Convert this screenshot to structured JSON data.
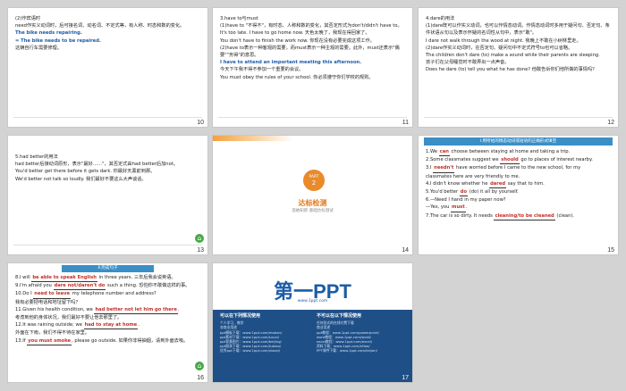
{
  "slides": {
    "s10": {
      "page": "10",
      "lines": [
        "(2)作宾语时",
        "need作实义动词时，后可接名词、动名词、不定式等，有人称、时态和数的变化。",
        "The bike needs repairing.",
        "= The bike needs to be repaired.",
        "这辆自行车需要修理。"
      ]
    },
    "s11": {
      "page": "11",
      "lines": [
        "3.have to与must",
        "(1)have to \"不得不\"，有时态、人称和数的变化，其否定形式为don't/didn't have to。",
        "It's too late. I have to go home now. 天色太晚了，我现在得回家了。",
        "You don't have to finish the work now. 你现在没有必要完成这项工作。",
        "(2)have to表示一种客观的需要，而must表示一种主观的需要。此外，must还表示\"偶要\"\"务得\"的意思。",
        "I have to attend an important meeting this afternoon.",
        "今天下午我不得不参加一个重要的会议。",
        "You must obey the rules of your school. 你必须遵守你们学校的规则。"
      ]
    },
    "s12": {
      "page": "12",
      "lines": [
        "4.dare的用法",
        "(1)dare既可以作实义动词，也可以作情态动词。作情态动词时多用于疑问句、否定句、条件状语从句以及表示怀疑的名词性从句中，表示\"敢\"。",
        "I dare not walk through the wood at night. 我晚上不敢在小树林里走。",
        "(2)dare作实义动词时，在否定句、疑问句中不定式符号to也可以省略。",
        "The children don't dare (to) make a sound while their parents are sleeping.",
        "孩子们在父母睡觉时不敢弄出一点声音。",
        "Does he dare (to) tell you what he has done? 他敢告诉你们他所做的事情吗？"
      ]
    },
    "s13": {
      "page": "13",
      "lines": [
        "5.had better的用法",
        "had better后接动词原形，表示\"最好……\"，其否定式由had better后加not。",
        "You'd better get there before it gets dark. 你最好天黑前到那。",
        "We'd better not talk so loudly. 我们最好不要这么大声谈话。"
      ]
    },
    "s14": {
      "page": "14",
      "part": "PART",
      "part_num": "2",
      "title": "达标检测",
      "subtitle": "温故知新  基础达标测试"
    },
    "s15": {
      "page": "15",
      "banner": "Ⅰ.用所给的情态动词或短语的正确形式填空",
      "lines": [
        {
          "pre": "1.We ",
          "ans": "can",
          "post": " choose between staying at home and taking a trip."
        },
        {
          "pre": "2.Some classmates suggest we ",
          "ans": "should",
          "post": " go to places of interest nearby."
        },
        {
          "pre": "3.I ",
          "ans": "needn't",
          "post": " have worried before I came to the new school, for my"
        },
        {
          "pre": "classmates here are very friendly to me.",
          "ans": "",
          "post": ""
        },
        {
          "pre": "4.I didn't know whether he ",
          "ans": "dared",
          "post": " say that to him."
        },
        {
          "pre": "5.You'd better ",
          "ans": "do",
          "post": " (do) it all by yourself."
        },
        {
          "pre": "6.—Need I hand in my paper now?",
          "ans": "",
          "post": ""
        },
        {
          "pre": "—Yes, you ",
          "ans": "must",
          "post": "."
        },
        {
          "pre": "7.The car is so dirty. It needs ",
          "ans": "cleaning/to be cleaned",
          "post": " (clean)."
        }
      ]
    },
    "s16": {
      "page": "16",
      "banner": "Ⅱ.完成句子",
      "lines": [
        {
          "pre": "8.I will ",
          "ans": "be able to speak English",
          "post": " in three years. 三年后我会说英语。"
        },
        {
          "pre": "9.I'm afraid you ",
          "ans": "dare not/daren't do",
          "post": " such a thing. 恐怕你不敢做这样的事。"
        },
        {
          "pre": "10.Do I ",
          "ans": "need to leave",
          "post": " my telephone number and address?"
        },
        {
          "pre": "我有必要把电话和地址留下吗？",
          "ans": "",
          "post": ""
        },
        {
          "pre": "11.Given his health condition, we ",
          "ans": "had better not let him go there",
          "post": "."
        },
        {
          "pre": "考虑到他的身体状况，我们最好不要让他去那里了。",
          "ans": "",
          "post": ""
        },
        {
          "pre": "12.It was raining outside; we ",
          "ans": "had to stay at home",
          "post": "."
        },
        {
          "pre": "外面在下雨，我们不得不待在家里。",
          "ans": "",
          "post": ""
        },
        {
          "pre": "13.If ",
          "ans": "you must smoke",
          "post": ", please go outside. 如果你非得抽烟，请到外面去吸。"
        }
      ]
    },
    "s17": {
      "page": "17",
      "logo": "第一PPT",
      "url": "www.1ppt.com",
      "left_title": "可以在下列情况使用",
      "left_lines": [
        "个人学习、教学",
        "非商业用途",
        "ppt模板下载：www.1ppt.com/moban/",
        "ppt素材下载：www.1ppt.com/sucai/",
        "ppt背景图片：www.1ppt.com/beijing/",
        "ppt图表下载：www.1ppt.com/tubiao/",
        "优秀ppt下载：www.1ppt.com/xiazai/"
      ],
      "right_title": "不可以在以下情况使用",
      "right_lines": [
        "任何形式的在线付费下载",
        "商业用途",
        "ppt教程：www.1ppt.com/powerpoint/",
        "word教程：www.1ppt.com/word/",
        "excel教程：www.1ppt.com/excel/",
        "资料下载：www.1ppt.com/ziliao/",
        "PPT课件下载：www.1ppt.com/kejian/"
      ]
    }
  },
  "colors": {
    "accent_blue": "#1e5aa8",
    "answer_red": "#c0302a",
    "banner": "#3a8fc7",
    "part_orange": "#e98a2b"
  }
}
